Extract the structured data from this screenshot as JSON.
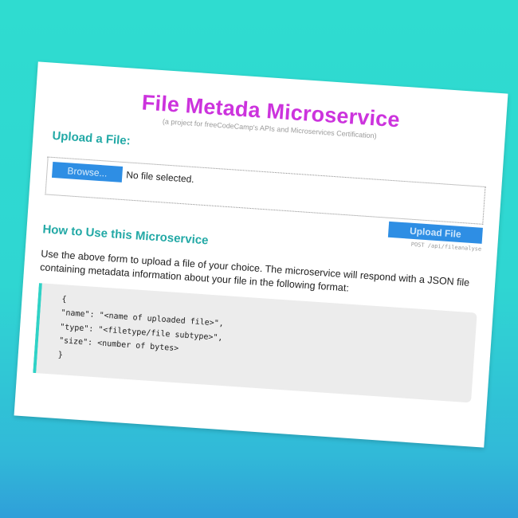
{
  "header": {
    "title": "File Metada Microservice",
    "subtitle": "(a project for freeCodeCamp's APIs and Microservices Certification)"
  },
  "upload": {
    "heading": "Upload a File:",
    "browse_label": "Browse...",
    "file_status": "No file selected.",
    "submit_label": "Upload File",
    "endpoint": "POST /api/fileanalyse"
  },
  "howto": {
    "heading": "How to Use this Microservice",
    "description": "Use the above form to upload a file of your choice. The microservice will respond with a JSON file containing metadata information about your file in the following format:"
  },
  "code": {
    "lines": [
      "{",
      "\"name\": \"<name of uploaded file>\",",
      "\"type\": \"<filetype/file subtype>\",",
      "\"size\": <number of bytes>",
      "}"
    ]
  },
  "colors": {
    "background_top": "#2fdcd0",
    "background_bottom": "#2f9fd9",
    "title": "#cc33dd",
    "heading": "#23a9a6",
    "button": "#2e8ee4",
    "code_accent": "#2fd2c6"
  }
}
